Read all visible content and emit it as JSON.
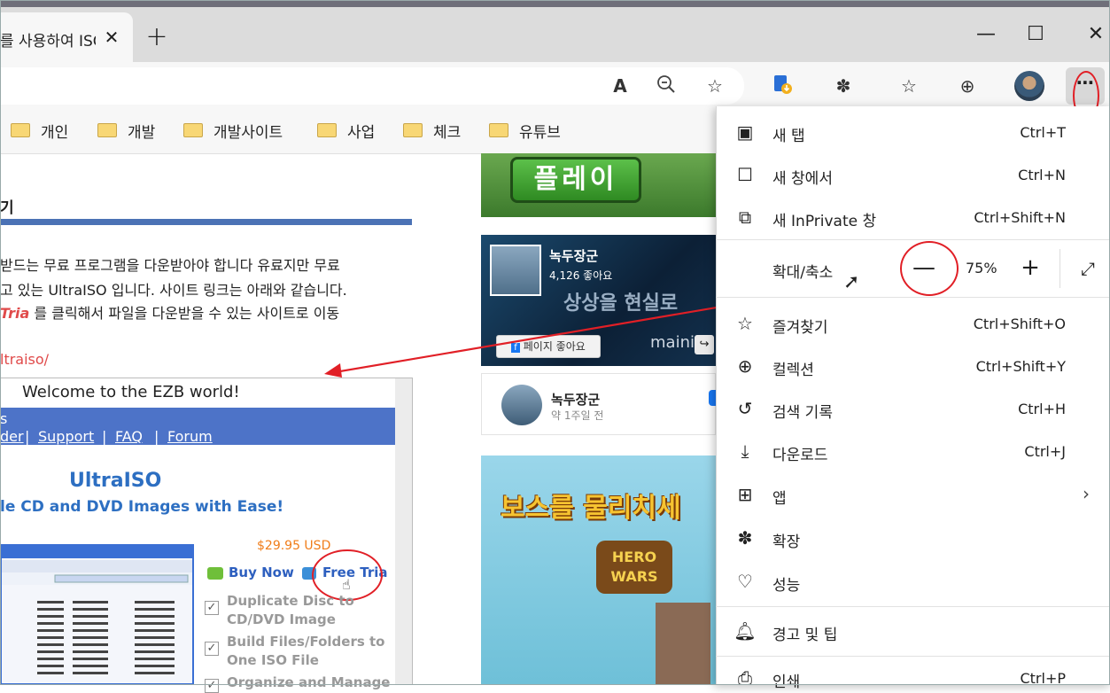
{
  "browser": {
    "tab_title": "를 사용하여 ISO",
    "tab_close": "✕",
    "new_tab": "+",
    "window_controls": {
      "minimize": "—",
      "maximize": "☐",
      "close": "✕"
    },
    "more_button": "⋯"
  },
  "bookmarks": [
    {
      "label": "개인"
    },
    {
      "label": "개발"
    },
    {
      "label": "개발사이트"
    },
    {
      "label": "사업"
    },
    {
      "label": "체크"
    },
    {
      "label": "유튜브"
    }
  ],
  "article": {
    "heading": "기",
    "lines": [
      "받드는 무료 프로그램을 다운받아야 합니다 유료지만 무료",
      "고 있는 UltraISO 입니다. 사이트 링크는 아래와 같습니다.",
      "를 클릭해서 파일을 다운받을 수 있는 사이트로 이동"
    ],
    "emphasis": "Tria",
    "url": "ltraiso/"
  },
  "site": {
    "welcome": "Welcome to the EZB world!",
    "nav_top": "s",
    "nav": [
      "der",
      "Support",
      "FAQ",
      "Forum"
    ],
    "nav_sep": "|",
    "product": "UltraISO",
    "tagline": "le CD and DVD Images with Ease!",
    "price": "$29.95 USD",
    "buy_now": "Buy Now",
    "free_trial": "Free Tria",
    "features": [
      "Duplicate Disc to",
      "CD/DVD Image",
      "Build Files/Folders to",
      "One ISO File",
      "Organize and Manage"
    ]
  },
  "ads": {
    "play_button": "플레이",
    "fb_page_name": "녹두장군",
    "fb_likes": "4,126 좋아요",
    "fb_slogan": "상상을 현실로",
    "fb_like_button": "페이지 좋아요",
    "fb_brand": "mainia",
    "post_name": "녹두장군",
    "post_time": "약 1주일 전",
    "game_title": "보스를 물리치세",
    "hero_logo": "HERO WARS"
  },
  "menu": {
    "items": [
      {
        "label": "새 탭",
        "shortcut": "Ctrl+T",
        "icon": "new-tab-icon"
      },
      {
        "label": "새 창에서",
        "shortcut": "Ctrl+N",
        "icon": "new-window-icon"
      },
      {
        "label": "새 InPrivate 창",
        "shortcut": "Ctrl+Shift+N",
        "icon": "inprivate-icon"
      }
    ],
    "zoom": {
      "label": "확대/축소",
      "minus": "—",
      "value": "75%",
      "plus": "+",
      "fullscreen": "⤢"
    },
    "items2": [
      {
        "label": "즐겨찾기",
        "shortcut": "Ctrl+Shift+O",
        "icon": "favorites-icon"
      },
      {
        "label": "컬렉션",
        "shortcut": "Ctrl+Shift+Y",
        "icon": "collections-icon"
      },
      {
        "label": "검색 기록",
        "shortcut": "Ctrl+H",
        "icon": "history-icon"
      },
      {
        "label": "다운로드",
        "shortcut": "Ctrl+J",
        "icon": "download-icon"
      },
      {
        "label": "앱",
        "shortcut": "",
        "icon": "apps-icon"
      },
      {
        "label": "확장",
        "shortcut": "",
        "icon": "extensions-icon"
      },
      {
        "label": "성능",
        "shortcut": "",
        "icon": "performance-icon"
      }
    ],
    "alerts": {
      "label": "경고 및 팁",
      "icon": "bell-icon"
    },
    "print": {
      "label": "인쇄",
      "shortcut": "Ctrl+P",
      "icon": "print-icon"
    }
  },
  "colors": {
    "annotation_red": "#e11f26",
    "accent_blue": "#4b72b5"
  }
}
